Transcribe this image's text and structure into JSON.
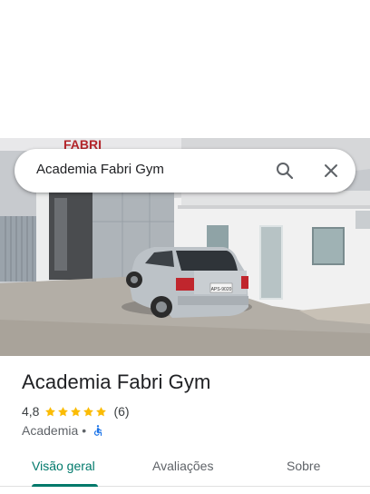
{
  "search": {
    "query": "Academia Fabri Gym"
  },
  "photo": {
    "sign_text": "FABRI",
    "plate_text": "APS-9020"
  },
  "place": {
    "name": "Academia Fabri Gym",
    "rating": "4,8",
    "stars": 5,
    "review_count": "(6)",
    "category": "Academia",
    "separator": "•"
  },
  "tabs": [
    {
      "label": "Visão geral",
      "active": true
    },
    {
      "label": "Avaliações",
      "active": false
    },
    {
      "label": "Sobre",
      "active": false
    }
  ],
  "colors": {
    "accent": "#00796b",
    "star": "#fbbc04",
    "accessibility": "#1a73e8"
  }
}
